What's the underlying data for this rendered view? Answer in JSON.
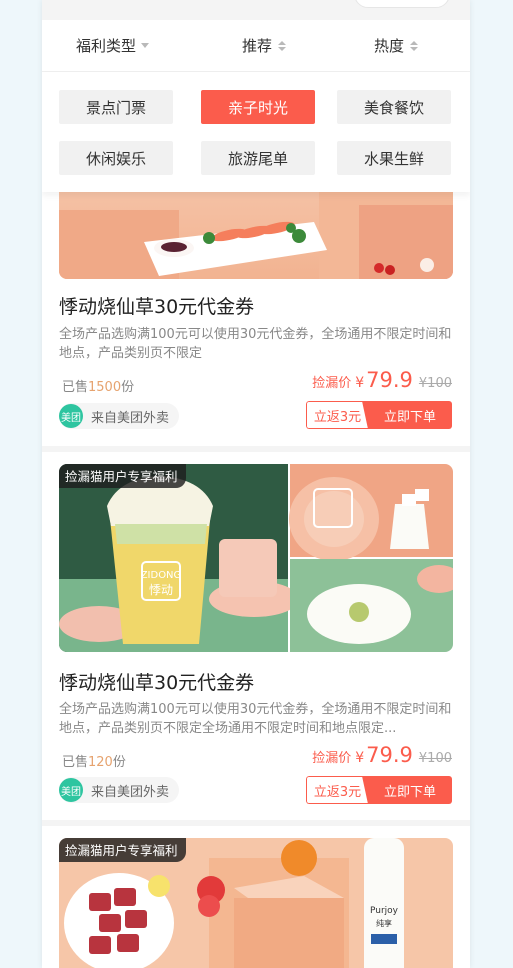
{
  "filters": [
    {
      "label": "福利类型",
      "indicator": "dropdown"
    },
    {
      "label": "推荐",
      "indicator": "sort"
    },
    {
      "label": "热度",
      "indicator": "sort"
    }
  ],
  "categories": [
    {
      "label": "景点门票",
      "active": false
    },
    {
      "label": "亲子时光",
      "active": true
    },
    {
      "label": "美食餐饮",
      "active": false
    },
    {
      "label": "休闲娱乐",
      "active": false
    },
    {
      "label": "旅游尾单",
      "active": false
    },
    {
      "label": "水果生鲜",
      "active": false
    }
  ],
  "cards": [
    {
      "tag": "",
      "title": "悸动烧仙草30元代金券",
      "desc": "全场产品选购满100元可以使用30元代金券，全场通用不限定时间和地点，产品类别页不限定",
      "sold_prefix": "已售",
      "sold_count": "1500",
      "sold_suffix": "份",
      "price_label": "捡漏价",
      "currency": "¥",
      "price": "79.9",
      "original_price": "¥100",
      "source_logo": "美团",
      "source_text": "来自美团外卖",
      "rebate": "立返3元",
      "order": "立即下单"
    },
    {
      "tag": "捡漏猫用户专享福利",
      "title": "悸动烧仙草30元代金券",
      "desc": "全场产品选购满100元可以使用30元代金券，全场通用不限定时间和地点，产品类别页不限定全场通用不限定时间和地点限定...",
      "sold_prefix": "已售",
      "sold_count": "120",
      "sold_suffix": "份",
      "price_label": "捡漏价",
      "currency": "¥",
      "price": "79.9",
      "original_price": "¥100",
      "source_logo": "美团",
      "source_text": "来自美团外卖",
      "rebate": "立返3元",
      "order": "立即下单",
      "cup_logo": "悸动",
      "cup_brand": "ZIDONG"
    },
    {
      "tag": "捡漏猫用户专享福利",
      "bottle_brand": "Purjoy",
      "bottle_sub": "纯享"
    }
  ],
  "colors": {
    "accent": "#fb5c4c",
    "meituan": "#2ec5a0",
    "sold_count": "#e6a36f"
  }
}
